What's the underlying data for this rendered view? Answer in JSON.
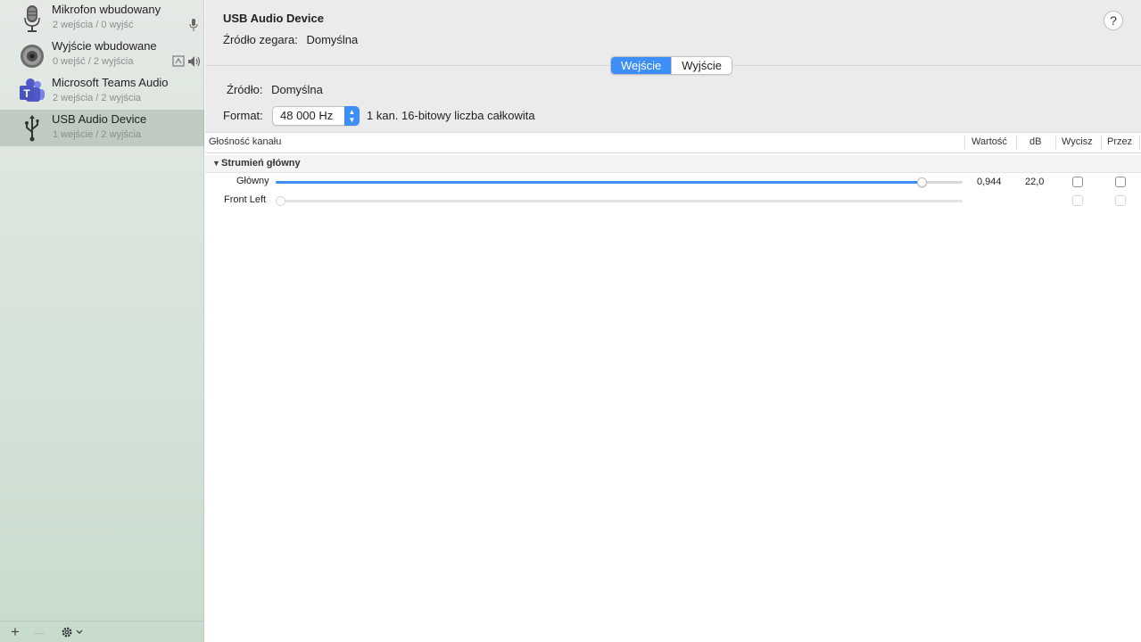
{
  "sidebar": {
    "devices": [
      {
        "name": "Mikrofon wbudowany",
        "io": "2 wejścia / 0 wyjść",
        "icon": "microphone-icon"
      },
      {
        "name": "Wyjście wbudowane",
        "io": "0 wejść / 2 wyjścia",
        "icon": "speaker-icon"
      },
      {
        "name": "Microsoft Teams Audio",
        "io": "2 wejścia / 2 wyjścia",
        "icon": "teams-icon"
      },
      {
        "name": "USB Audio Device",
        "io": "1 wejście / 2 wyjścia",
        "icon": "usb-icon",
        "selected": true
      }
    ],
    "footer": {
      "add": "+",
      "remove": "—"
    }
  },
  "main": {
    "title": "USB Audio Device",
    "clock_label": "Źródło zegara:",
    "clock_value": "Domyślna",
    "help": "?",
    "tabs": [
      {
        "label": "Wejście",
        "active": true
      },
      {
        "label": "Wyjście",
        "active": false
      }
    ],
    "source_label": "Źródło:",
    "source_value": "Domyślna",
    "format_label": "Format:",
    "format_value": "48 000 Hz",
    "format_desc": "1 kan. 16-bitowy liczba całkowita",
    "table": {
      "columns": [
        "Głośność kanału",
        "Wartość",
        "dB",
        "Wycisz",
        "Przez"
      ],
      "group": "Strumień główny",
      "rows": [
        {
          "label": "Główny",
          "value": "0,944",
          "db": "22,0",
          "level": 0.94,
          "enabled": true
        },
        {
          "label": "Front Left",
          "value": "",
          "db": "",
          "level": 0,
          "enabled": false
        }
      ]
    }
  },
  "colors": {
    "accent": "#3d8ef7"
  }
}
